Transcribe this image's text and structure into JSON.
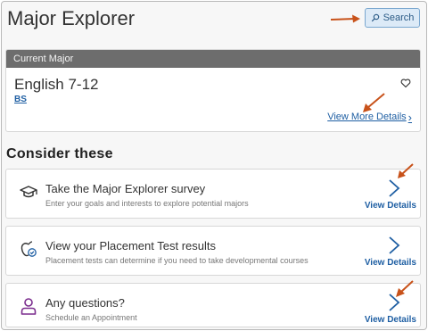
{
  "header": {
    "title": "Major Explorer",
    "search_label": "Search"
  },
  "current_major": {
    "header_label": "Current Major",
    "name": "English 7-12",
    "degree": "BS",
    "view_more_label": "View More Details",
    "view_more_chevron": "›"
  },
  "consider": {
    "title": "Consider these",
    "items": [
      {
        "icon": "graduation-cap-icon",
        "title": "Take the Major Explorer survey",
        "description": "Enter your goals and interests to explore potential majors",
        "action_label": "View Details"
      },
      {
        "icon": "apple-check-icon",
        "title": "View your Placement Test results",
        "description": "Placement tests can determine if you need to take developmental courses",
        "action_label": "View Details"
      },
      {
        "icon": "person-icon",
        "title": "Any questions?",
        "description": "Schedule an Appointment",
        "action_label": "View Details"
      }
    ]
  },
  "colors": {
    "accent": "#1f5fa3",
    "header_bar": "#6d6d6d",
    "annotation_arrow": "#c8521a",
    "person_icon": "#7b2d8e"
  }
}
